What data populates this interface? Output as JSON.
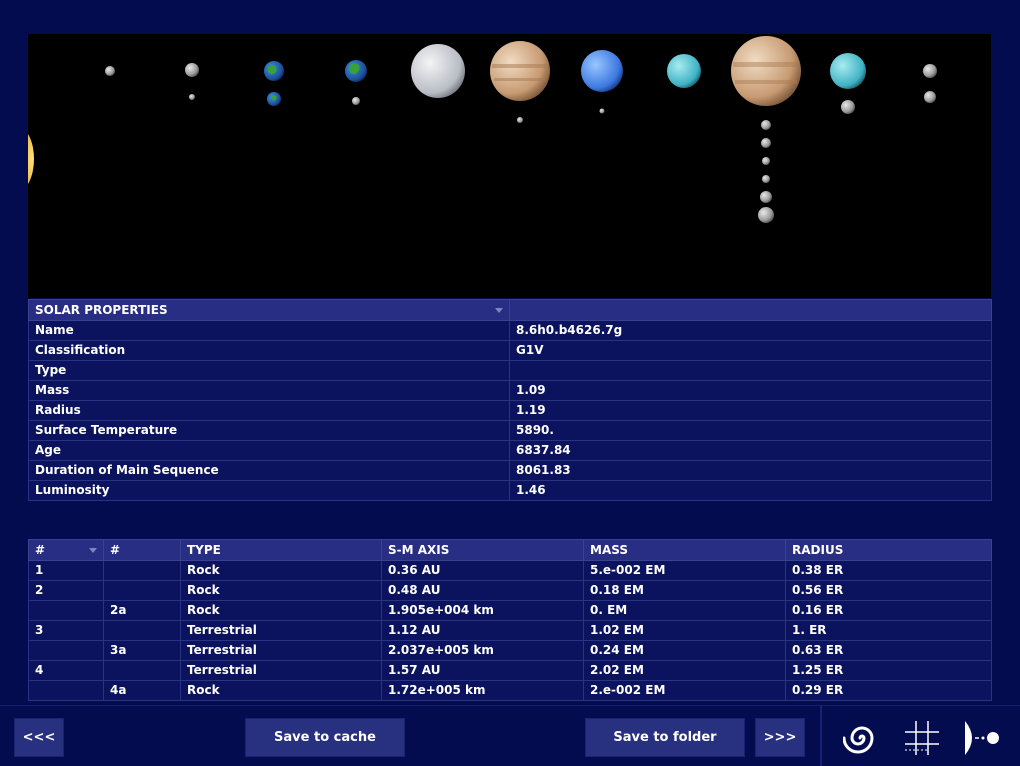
{
  "solar_properties": {
    "header": "SOLAR PROPERTIES",
    "rows": [
      {
        "label": "Name",
        "value": "8.6h0.b4626.7g"
      },
      {
        "label": "Classification",
        "value": "G1V"
      },
      {
        "label": "Type",
        "value": ""
      },
      {
        "label": "Mass",
        "value": "1.09"
      },
      {
        "label": "Radius",
        "value": "1.19"
      },
      {
        "label": "Surface Temperature",
        "value": "5890."
      },
      {
        "label": "Age",
        "value": "6837.84"
      },
      {
        "label": "Duration of Main Sequence",
        "value": "8061.83"
      },
      {
        "label": "Luminosity",
        "value": "1.46"
      }
    ]
  },
  "planets": {
    "columns": [
      "#",
      "#",
      "TYPE",
      "S-M AXIS",
      "MASS",
      "RADIUS"
    ],
    "rows": [
      {
        "num": "1",
        "moon": "",
        "type": "Rock",
        "axis": "0.36 AU",
        "mass": "5.e-002 EM",
        "radius": "0.38 ER"
      },
      {
        "num": "2",
        "moon": "",
        "type": "Rock",
        "axis": "0.48 AU",
        "mass": "0.18 EM",
        "radius": "0.56 ER"
      },
      {
        "num": "",
        "moon": "2a",
        "type": "Rock",
        "axis": "1.905e+004 km",
        "mass": "0. EM",
        "radius": "0.16 ER"
      },
      {
        "num": "3",
        "moon": "",
        "type": "Terrestrial",
        "axis": "1.12 AU",
        "mass": "1.02 EM",
        "radius": "1. ER"
      },
      {
        "num": "",
        "moon": "3a",
        "type": "Terrestrial",
        "axis": "2.037e+005 km",
        "mass": "0.24 EM",
        "radius": "0.63 ER"
      },
      {
        "num": "4",
        "moon": "",
        "type": "Terrestrial",
        "axis": "1.57 AU",
        "mass": "2.02 EM",
        "radius": "1.25 ER"
      },
      {
        "num": "",
        "moon": "4a",
        "type": "Rock",
        "axis": "1.72e+005 km",
        "mass": "2.e-002 EM",
        "radius": "0.29 ER"
      }
    ]
  },
  "buttons": {
    "prev": "<<<",
    "save_cache": "Save to cache",
    "save_folder": "Save to folder",
    "next": ">>>"
  },
  "icons": [
    "galaxy-icon",
    "grid-icon",
    "system-view-icon"
  ]
}
